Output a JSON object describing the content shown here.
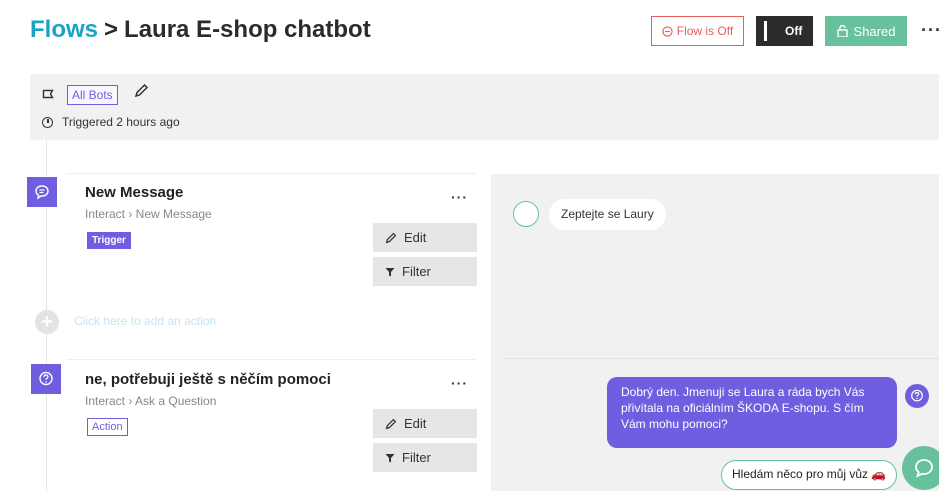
{
  "header": {
    "breadcrumb_root": "Flows",
    "breadcrumb_sep": ">",
    "flow_name": "Laura E-shop chatbot",
    "status_label": "Flow is Off",
    "toggle_label": "Off",
    "shared_label": "Shared",
    "more_label": "···"
  },
  "info": {
    "bot_filter": "All Bots",
    "triggered": "Triggered 2 hours ago"
  },
  "steps": [
    {
      "title": "New Message",
      "path": "Interact › New Message",
      "badge": "Trigger",
      "more": "···",
      "edit_label": "Edit",
      "filter_label": "Filter"
    },
    {
      "title": "ne, potřebuji ještě s něčím pomoci",
      "path": "Interact › Ask a Question",
      "badge": "Action",
      "more": "···",
      "edit_label": "Edit",
      "filter_label": "Filter"
    }
  ],
  "add_action": "Click here to add an action",
  "chat": {
    "user_message": "Zeptejte se Laury",
    "bot_message": "Dobrý den. Jmenuji se Laura a ráda bych Vás přivítala na oficiálním ŠKODA E-shopu. S čím Vám mohu pomoci?",
    "quick_reply": "Hledám něco pro můj vůz 🚗"
  },
  "colors": {
    "accent": "#6f5fe0",
    "brand_blue": "#1aa3c7",
    "success": "#67c19c",
    "danger": "#e35d5d"
  }
}
